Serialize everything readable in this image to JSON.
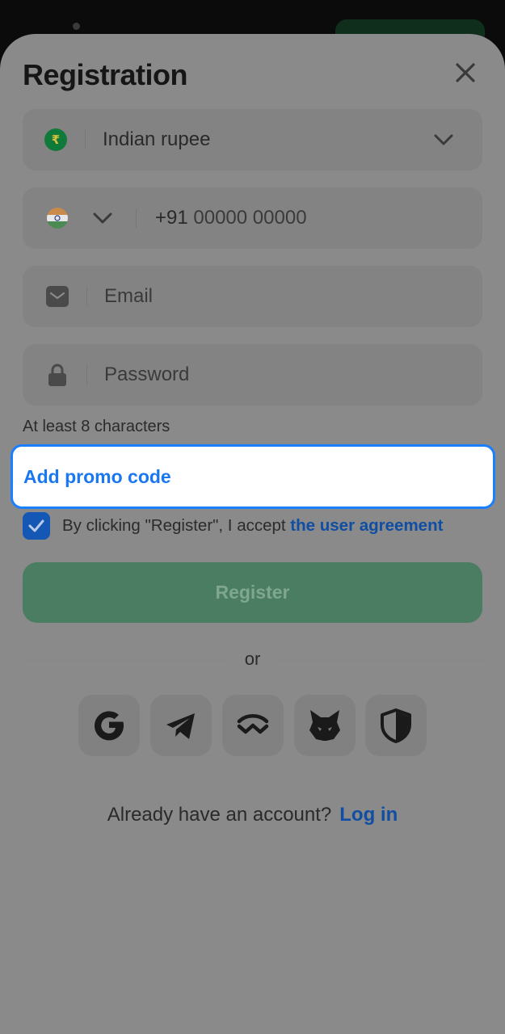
{
  "modal": {
    "title": "Registration"
  },
  "currency": {
    "symbol": "₹",
    "label": "Indian rupee"
  },
  "phone": {
    "code": "+91",
    "placeholder": "00000 00000"
  },
  "email": {
    "placeholder": "Email"
  },
  "password": {
    "placeholder": "Password",
    "hint": "At least 8 characters"
  },
  "promo": {
    "label": "Add promo code"
  },
  "agreement": {
    "checked": true,
    "text": "By clicking \"Register\", I accept ",
    "link": "the user agreement"
  },
  "register": {
    "label": "Register"
  },
  "divider": {
    "label": "or"
  },
  "social": [
    "google-icon",
    "telegram-icon",
    "walletconnect-icon",
    "metamask-icon",
    "shield-icon"
  ],
  "login": {
    "prompt": "Already have an account?",
    "link": "Log in"
  },
  "colors": {
    "accent": "#1a77f0",
    "link": "#0f4ea3",
    "register_bg": "#4a7d61",
    "overlay": "#8a8a8a"
  }
}
